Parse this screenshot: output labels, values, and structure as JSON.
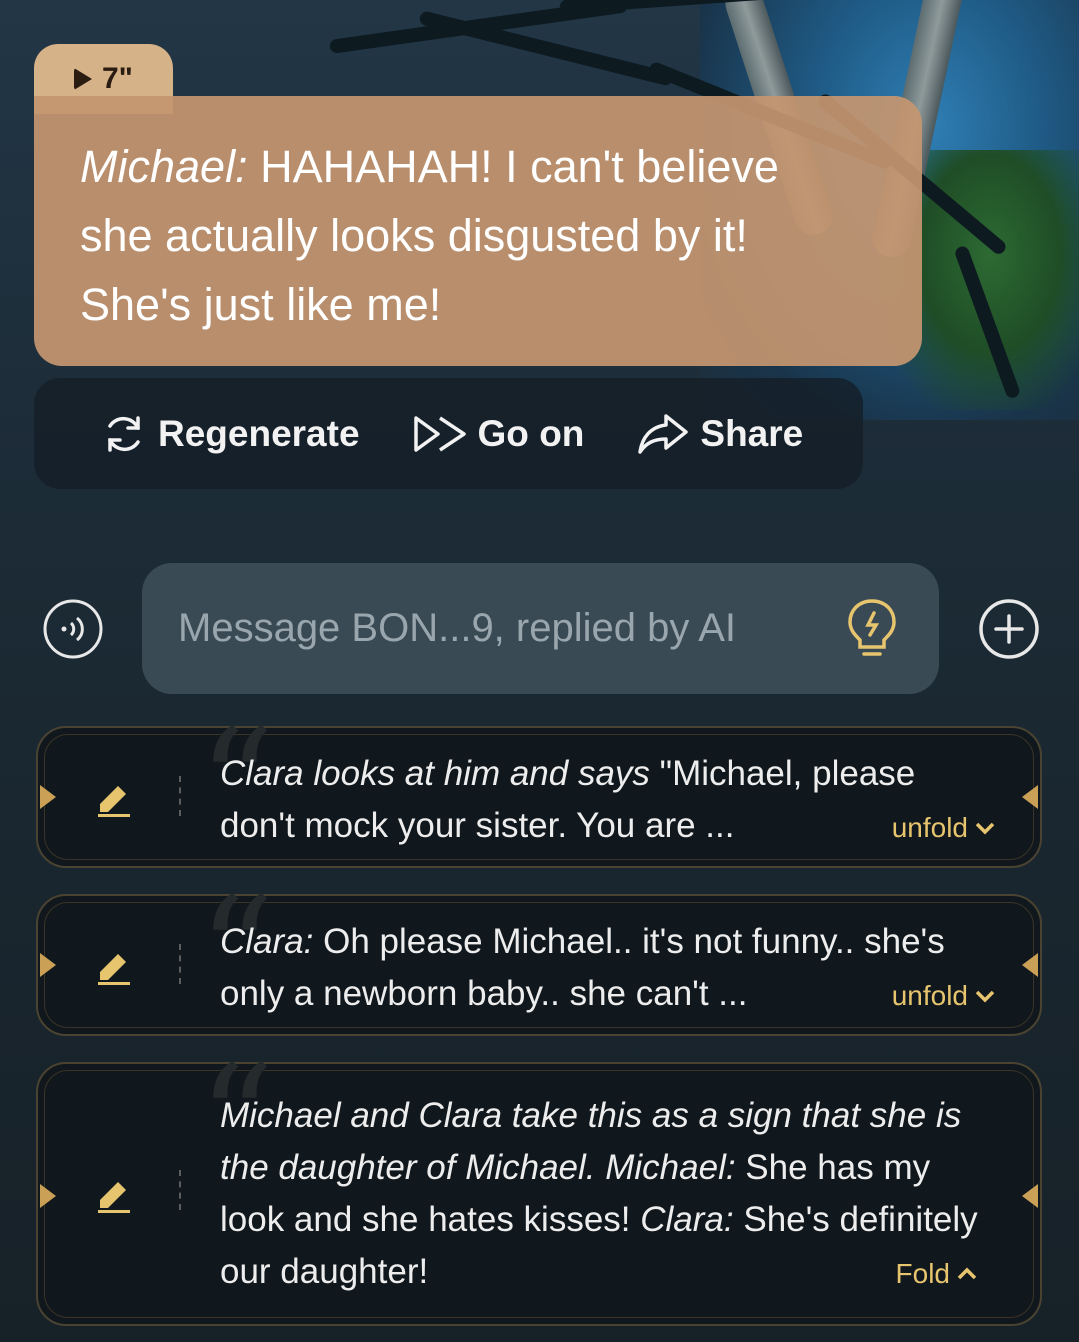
{
  "message": {
    "duration": "7\"",
    "speaker": "Michael:",
    "text_line1": " HAHAHAH! I can't believe",
    "text_line2": "she actually looks disgusted by it!",
    "text_line3": "She's just like me!"
  },
  "actions": {
    "regenerate": "Regenerate",
    "go_on": "Go on",
    "share": "Share"
  },
  "input": {
    "placeholder": "Message BON...9, replied by AI",
    "value": ""
  },
  "suggestions": [
    {
      "italic": "Clara looks at him and says",
      "text_a": " \"Michael, please",
      "text_b": "don't mock your sister. You are ...",
      "toggle": "unfold"
    },
    {
      "italic": "Clara:",
      "text_a": " Oh please Michael.. it's not funny.. she's",
      "text_b": "only a newborn baby.. she can't ...",
      "toggle": "unfold"
    },
    {
      "italic_a": "Michael and Clara take this as a sign that she is",
      "italic_b": "the daughter of Michael. Michael:",
      "text_c": " She has my",
      "text_d": "look and she hates kisses! ",
      "italic_e": "Clara:",
      "text_f": " She's definitely",
      "text_g": "our daughter!",
      "toggle": "Fold"
    }
  ],
  "colors": {
    "bubble": "#c49670",
    "accent_gold": "#e7c46e",
    "card_bg": "#11181d"
  }
}
